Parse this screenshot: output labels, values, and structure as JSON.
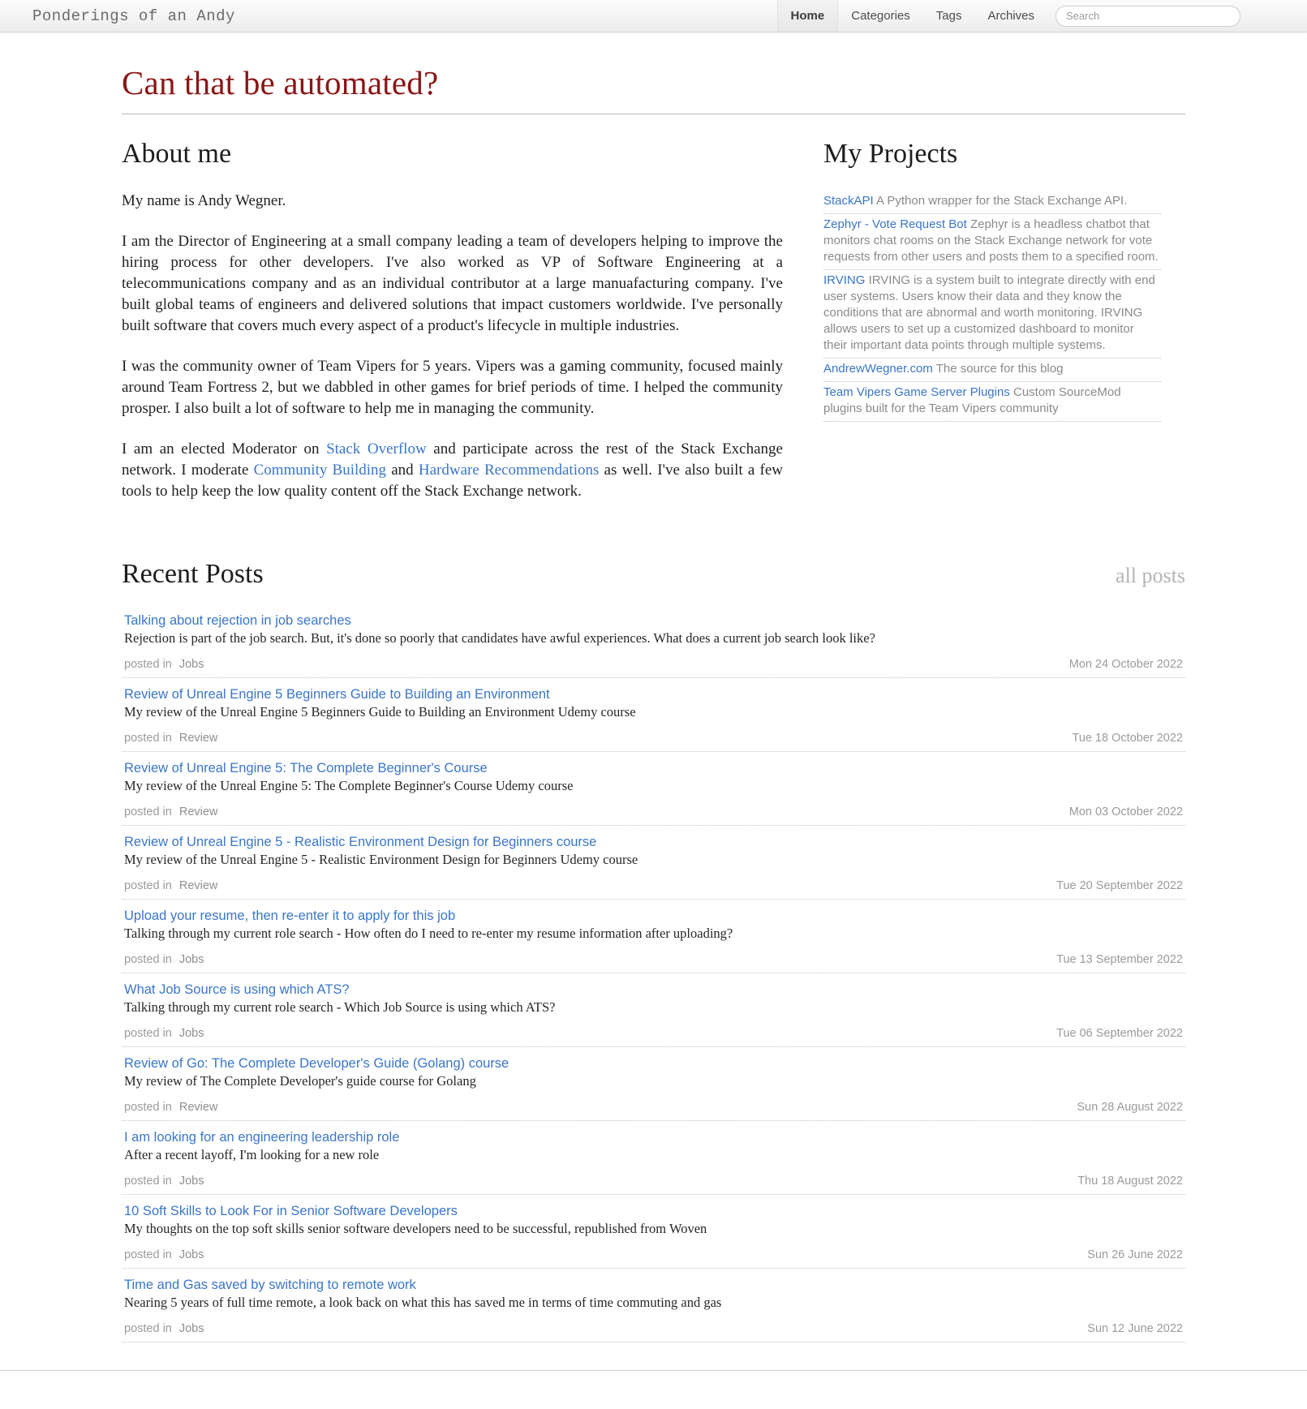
{
  "header": {
    "site_title": "Ponderings of an Andy",
    "nav": [
      {
        "label": "Home",
        "active": true
      },
      {
        "label": "Categories",
        "active": false
      },
      {
        "label": "Tags",
        "active": false
      },
      {
        "label": "Archives",
        "active": false
      }
    ],
    "search_placeholder": "Search"
  },
  "blog": {
    "title": "Can that be automated?"
  },
  "about": {
    "heading": "About me",
    "p1": "My name is Andy Wegner.",
    "p2": "I am the Director of Engineering at a small company leading a team of developers helping to improve the hiring process for other developers. I've also worked as VP of Software Engineering at a telecommunications company and as an individual contributor at a large manuafacturing company. I've built global teams of engineers and delivered solutions that impact customers worldwide. I've personally built software that covers much every aspect of a product's lifecycle in multiple industries.",
    "p3": "I was the community owner of Team Vipers for 5 years. Vipers was a gaming community, focused mainly around Team Fortress 2, but we dabbled in other games for brief periods of time. I helped the community prosper. I also built a lot of software to help me in managing the community.",
    "p4_a": "I am an elected Moderator on ",
    "p4_link1": "Stack Overflow",
    "p4_b": " and participate across the rest of the Stack Exchange network. I moderate ",
    "p4_link2": "Community Building",
    "p4_c": " and ",
    "p4_link3": "Hardware Recommendations",
    "p4_d": " as well. I've also built a few tools to help keep the low quality content off the Stack Exchange network."
  },
  "projects": {
    "heading": "My Projects",
    "items": [
      {
        "name": "StackAPI",
        "desc": "A Python wrapper for the Stack Exchange API."
      },
      {
        "name": "Zephyr - Vote Request Bot",
        "desc": "Zephyr is a headless chatbot that monitors chat rooms on the Stack Exchange network for vote requests from other users and posts them to a specified room."
      },
      {
        "name": "IRVING",
        "desc": "IRVING is a system built to integrate directly with end user systems. Users know their data and they know the conditions that are abnormal and worth monitoring. IRVING allows users to set up a customized dashboard to monitor their important data points through multiple systems."
      },
      {
        "name": "AndrewWegner.com",
        "desc": "The source for this blog"
      },
      {
        "name": "Team Vipers Game Server Plugins",
        "desc": "Custom SourceMod plugins built for the Team Vipers community"
      }
    ]
  },
  "recent": {
    "heading": "Recent Posts",
    "all_posts_label": "all posts",
    "posted_in_label": "posted in",
    "posts": [
      {
        "title": "Talking about rejection in job searches",
        "excerpt": "Rejection is part of the job search. But, it's done so poorly that candidates have awful experiences. What does a current job search look like?",
        "category": "Jobs",
        "date": "Mon 24 October 2022"
      },
      {
        "title": "Review of Unreal Engine 5 Beginners Guide to Building an Environment",
        "excerpt": "My review of the Unreal Engine 5 Beginners Guide to Building an Environment Udemy course",
        "category": "Review",
        "date": "Tue 18 October 2022"
      },
      {
        "title": "Review of Unreal Engine 5: The Complete Beginner's Course",
        "excerpt": "My review of the Unreal Engine 5: The Complete Beginner's Course Udemy course",
        "category": "Review",
        "date": "Mon 03 October 2022"
      },
      {
        "title": "Review of Unreal Engine 5 - Realistic Environment Design for Beginners course",
        "excerpt": "My review of the Unreal Engine 5 - Realistic Environment Design for Beginners Udemy course",
        "category": "Review",
        "date": "Tue 20 September 2022"
      },
      {
        "title": "Upload your resume, then re-enter it to apply for this job",
        "excerpt": "Talking through my current role search - How often do I need to re-enter my resume information after uploading?",
        "category": "Jobs",
        "date": "Tue 13 September 2022"
      },
      {
        "title": "What Job Source is using which ATS?",
        "excerpt": "Talking through my current role search - Which Job Source is using which ATS?",
        "category": "Jobs",
        "date": "Tue 06 September 2022"
      },
      {
        "title": "Review of Go: The Complete Developer's Guide (Golang) course",
        "excerpt": "My review of The Complete Developer's guide course for Golang",
        "category": "Review",
        "date": "Sun 28 August 2022"
      },
      {
        "title": "I am looking for an engineering leadership role",
        "excerpt": "After a recent layoff, I'm looking for a new role",
        "category": "Jobs",
        "date": "Thu 18 August 2022"
      },
      {
        "title": "10 Soft Skills to Look For in Senior Software Developers",
        "excerpt": "My thoughts on the top soft skills senior software developers need to be successful, republished from Woven",
        "category": "Jobs",
        "date": "Sun 26 June 2022"
      },
      {
        "title": "Time and Gas saved by switching to remote work",
        "excerpt": "Nearing 5 years of full time remote, a look back on what this has saved me in terms of time commuting and gas",
        "category": "Jobs",
        "date": "Sun 12 June 2022"
      }
    ]
  },
  "colors": {
    "accent_red": "#8c1515",
    "link_blue": "#3a76c8",
    "muted_gray": "#9b9b9b"
  }
}
